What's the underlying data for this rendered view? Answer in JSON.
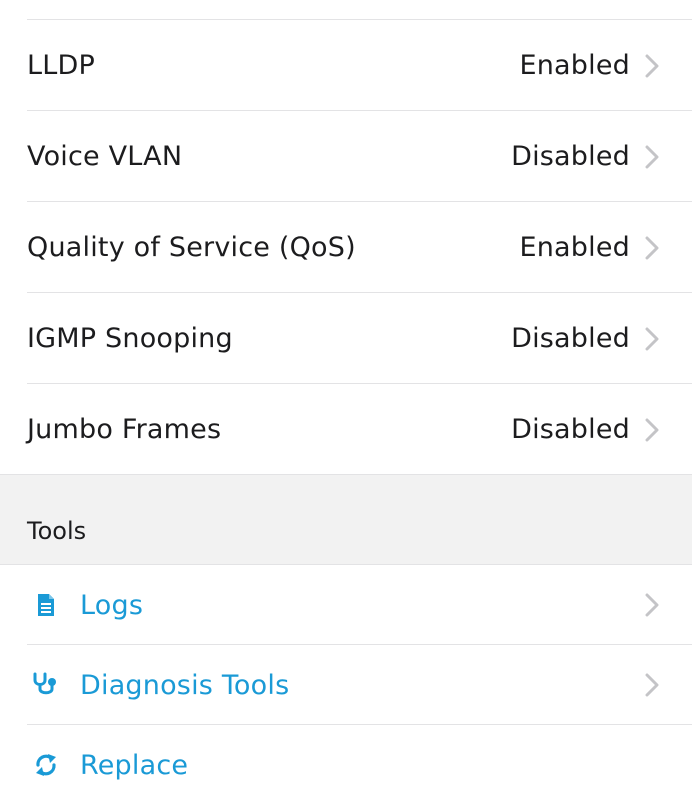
{
  "settings": {
    "items": [
      {
        "label": "LLDP",
        "value": "Enabled"
      },
      {
        "label": "Voice VLAN",
        "value": "Disabled"
      },
      {
        "label": "Quality of Service (QoS)",
        "value": "Enabled"
      },
      {
        "label": "IGMP Snooping",
        "value": "Disabled"
      },
      {
        "label": "Jumbo Frames",
        "value": "Disabled"
      }
    ]
  },
  "tools": {
    "header": "Tools",
    "items": [
      {
        "label": "Logs",
        "icon": "document-icon"
      },
      {
        "label": "Diagnosis Tools",
        "icon": "stethoscope-icon"
      },
      {
        "label": "Replace",
        "icon": "replace-icon"
      }
    ]
  },
  "colors": {
    "accent": "#1a9ad6",
    "text": "#1c1c1e",
    "chevron": "#c4c4c7",
    "section_bg": "#f2f2f2",
    "separator": "#e3e3e5"
  }
}
